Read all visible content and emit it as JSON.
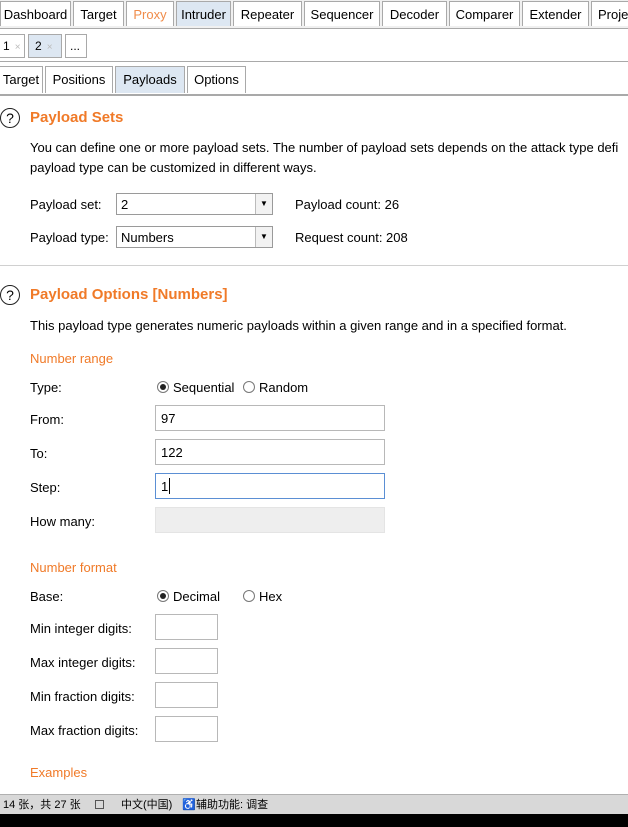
{
  "top_tabs": [
    "Dashboard",
    "Target",
    "Proxy",
    "Intruder",
    "Repeater",
    "Sequencer",
    "Decoder",
    "Comparer",
    "Extender",
    "Proje"
  ],
  "sub_tabs": [
    {
      "label": "1",
      "close": "×"
    },
    {
      "label": "2",
      "close": "×"
    },
    {
      "label": "..."
    }
  ],
  "inner_tabs": [
    "Target",
    "Positions",
    "Payloads",
    "Options"
  ],
  "help_glyph": "?",
  "payload_sets": {
    "title": "Payload Sets",
    "desc_line1": "You can define one or more payload sets. The number of payload sets depends on the attack type defi",
    "desc_line2": "payload type can be customized in different ways.",
    "set_label": "Payload set:",
    "set_value": "2",
    "type_label": "Payload type:",
    "type_value": "Numbers",
    "payload_count": "Payload count: 26",
    "request_count": "Request count: 208"
  },
  "payload_options": {
    "title": "Payload Options [Numbers]",
    "desc": "This payload type generates numeric payloads within a given range and in a specified format.",
    "number_range_heading": "Number range",
    "type_label": "Type:",
    "type_options": [
      "Sequential",
      "Random"
    ],
    "type_selected": "Sequential",
    "from_label": "From:",
    "from_value": "97",
    "to_label": "To:",
    "to_value": "122",
    "step_label": "Step:",
    "step_value": "1",
    "how_many_label": "How many:",
    "number_format_heading": "Number format",
    "base_label": "Base:",
    "base_options": [
      "Decimal",
      "Hex"
    ],
    "base_selected": "Decimal",
    "min_int_label": "Min integer digits:",
    "max_int_label": "Max integer digits:",
    "min_frac_label": "Min fraction digits:",
    "max_frac_label": "Max fraction digits:",
    "examples_heading": "Examples"
  },
  "status_bar": {
    "count": "14 张，共 27 张",
    "lang": "中文(中国)",
    "accessibility": "辅助功能: 调查"
  },
  "colors": {
    "accent_orange": "#f07a28",
    "proxy_tab_orange": "#f08c4a",
    "active_tab_bg": "#dde7f2"
  }
}
